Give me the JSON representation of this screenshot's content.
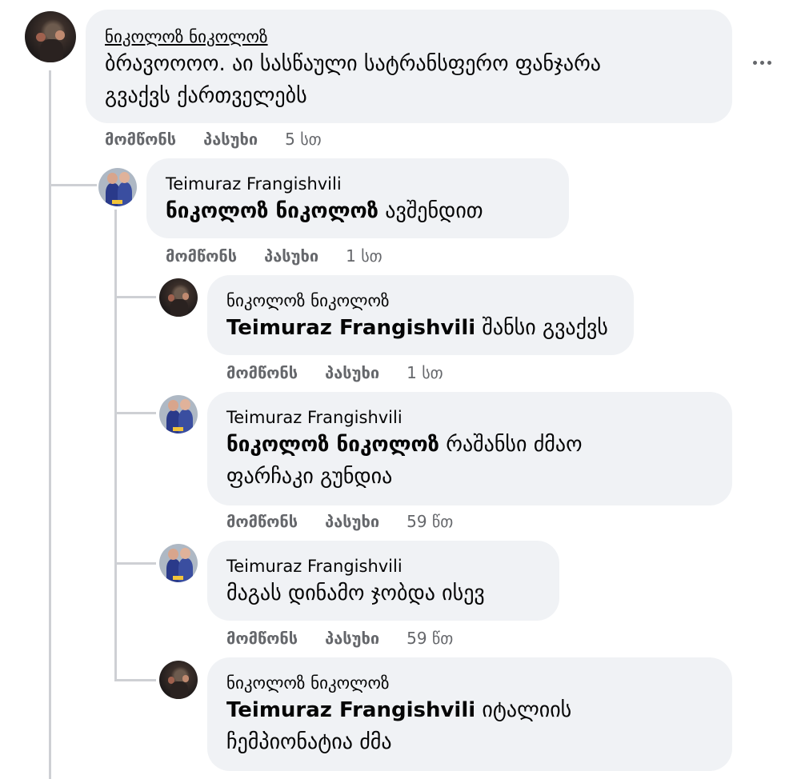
{
  "labels": {
    "like": "მომწონს",
    "reply": "პასუხი"
  },
  "comments": [
    {
      "author": "ნიკოლოზ ნიკოლოზ",
      "line1": "ბრავოოოო. აი სასწაული სატრანსფერო ფანჯარა",
      "line2": "გვაქვს ქართველებს",
      "time": "5 სთ"
    },
    {
      "author": "Teimuraz Frangishvili",
      "mention": "ნიკოლოზ ნიკოლოზ",
      "text": " ავშენდით",
      "time": "1 სთ"
    },
    {
      "author": "ნიკოლოზ ნიკოლოზ",
      "mention": "Teimuraz Frangishvili",
      "text": " შანსი გვაქვს",
      "time": "1 სთ"
    },
    {
      "author": "Teimuraz Frangishvili",
      "mention": "ნიკოლოზ ნიკოლოზ",
      "text": " რაშანსი ძმაო",
      "line2": "ფარჩაკი გუნდია",
      "time": "59 წთ"
    },
    {
      "author": "Teimuraz Frangishvili",
      "text": "მაგას დინამო ჯობდა ისევ",
      "time": "59 წთ"
    },
    {
      "author": "ნიკოლოზ ნიკოლოზ",
      "mention": "Teimuraz Frangishvili",
      "text": " იტალიის",
      "line2": "ჩემპიონატია ძმა"
    }
  ],
  "icons": {
    "more": "more-options-icon"
  }
}
